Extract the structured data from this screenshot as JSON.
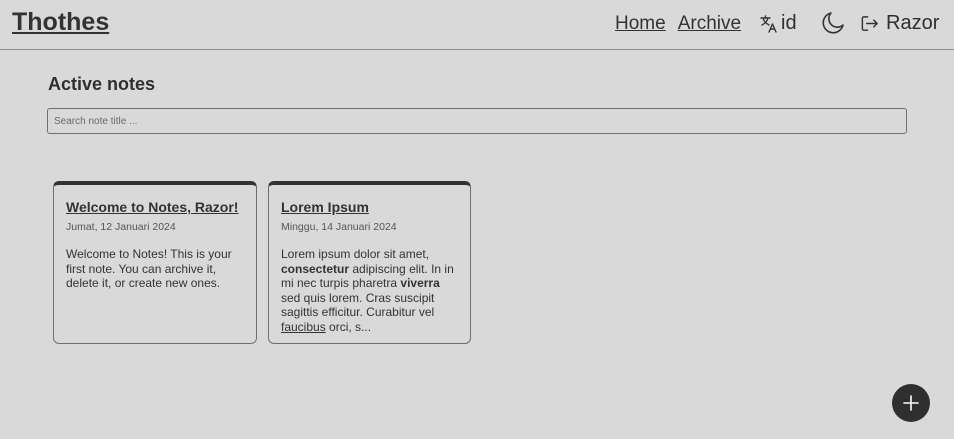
{
  "header": {
    "brand": "Thothes",
    "nav": {
      "home": "Home",
      "archive": "Archive"
    },
    "language_code": "id",
    "language_icon": "translate-icon",
    "theme_icon": "moon-icon",
    "logout_icon": "logout-icon",
    "user_name": "Razor"
  },
  "main": {
    "title": "Active notes",
    "search_placeholder": "Search note title ..."
  },
  "notes": [
    {
      "title": "Welcome to Notes, Razor!",
      "date": "Jumat, 12 Januari 2024",
      "body": "Welcome to Notes! This is your first note. You can archive it, delete it, or create new ones."
    },
    {
      "title": "Lorem Ipsum",
      "date": "Minggu, 14 Januari 2024",
      "body_parts": [
        "Lorem ipsum dolor sit amet, ",
        "consectetur",
        " adipiscing elit. In in mi nec turpis pharetra ",
        "viverra",
        " sed quis lorem. Cras suscipit sagittis efficitur. Curabitur vel ",
        "faucibus",
        " orci, s..."
      ]
    }
  ],
  "fab_icon": "plus-icon",
  "colors": {
    "background": "#d9d9d9",
    "text": "#2f2f2f",
    "accent": "#2f2f2f"
  }
}
